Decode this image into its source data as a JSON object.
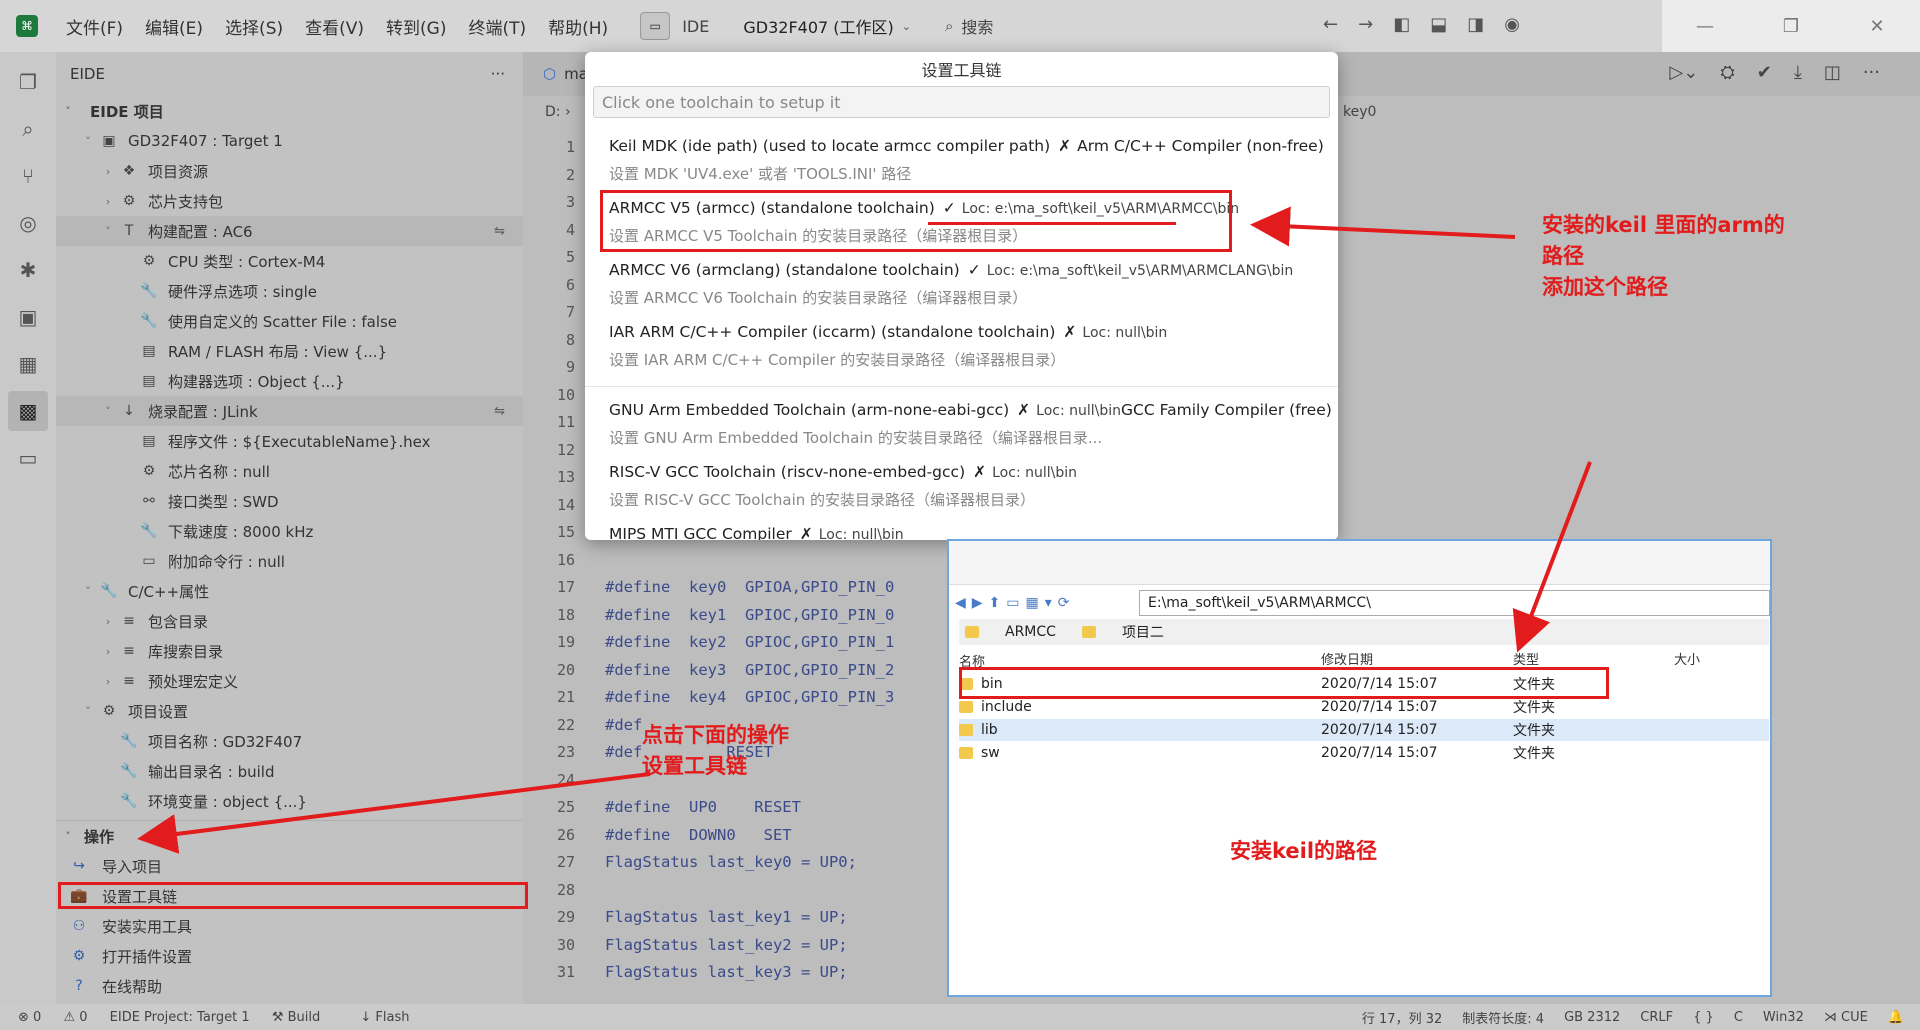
{
  "titlebar": {
    "menu": [
      "文件(F)",
      "编辑(E)",
      "选择(S)",
      "查看(V)",
      "转到(G)",
      "终端(T)",
      "帮助(H)"
    ],
    "ide_label": "IDE",
    "workspace": "GD32F407 (工作区)",
    "search": "搜索"
  },
  "sidebar": {
    "title": "EIDE",
    "more": "···",
    "tree": [
      {
        "label": "EIDE 项目",
        "indent": 0,
        "chev": "˅",
        "icon": "",
        "section": true
      },
      {
        "label": "GD32F407 : Target 1",
        "indent": 1,
        "chev": "˅",
        "icon": "▣"
      },
      {
        "label": "项目资源",
        "indent": 2,
        "chev": "›",
        "icon": "❖"
      },
      {
        "label": "芯片支持包",
        "indent": 2,
        "chev": "›",
        "icon": "⚙"
      },
      {
        "label": "构建配置 : AC6",
        "indent": 2,
        "chev": "˅",
        "icon": "T",
        "sel": true,
        "right": "⇋"
      },
      {
        "label": "CPU 类型 : Cortex-M4",
        "indent": 3,
        "chev": "",
        "icon": "⚙"
      },
      {
        "label": "硬件浮点选项 : single",
        "indent": 3,
        "chev": "",
        "icon": "🔧"
      },
      {
        "label": "使用自定义的 Scatter File : false",
        "indent": 3,
        "chev": "",
        "icon": "🔧"
      },
      {
        "label": "RAM / FLASH 布局 : View {...}",
        "indent": 3,
        "chev": "",
        "icon": "▤"
      },
      {
        "label": "构建器选项 : Object {...}",
        "indent": 3,
        "chev": "",
        "icon": "▤"
      },
      {
        "label": "烧录配置 : JLink",
        "indent": 2,
        "chev": "˅",
        "icon": "↓",
        "sel": true,
        "right": "⇋"
      },
      {
        "label": "程序文件 : ${ExecutableName}.hex",
        "indent": 3,
        "chev": "",
        "icon": "▤"
      },
      {
        "label": "芯片名称 : null",
        "indent": 3,
        "chev": "",
        "icon": "⚙"
      },
      {
        "label": "接口类型 : SWD",
        "indent": 3,
        "chev": "",
        "icon": "⚯"
      },
      {
        "label": "下载速度 : 8000 kHz",
        "indent": 3,
        "chev": "",
        "icon": "🔧"
      },
      {
        "label": "附加命令行 : null",
        "indent": 3,
        "chev": "",
        "icon": "▭"
      },
      {
        "label": "C/C++属性",
        "indent": 1,
        "chev": "˅",
        "icon": "🔧"
      },
      {
        "label": "包含目录",
        "indent": 2,
        "chev": "›",
        "icon": "≡"
      },
      {
        "label": "库搜索目录",
        "indent": 2,
        "chev": "›",
        "icon": "≡"
      },
      {
        "label": "预处理宏定义",
        "indent": 2,
        "chev": "›",
        "icon": "≡"
      },
      {
        "label": "项目设置",
        "indent": 1,
        "chev": "˅",
        "icon": "⚙"
      },
      {
        "label": "项目名称 : GD32F407",
        "indent": 2,
        "chev": "",
        "icon": "🔧"
      },
      {
        "label": "输出目录名 : build",
        "indent": 2,
        "chev": "",
        "icon": "🔧"
      },
      {
        "label": "环境变量 : object {...}",
        "indent": 2,
        "chev": "",
        "icon": "🔧"
      }
    ],
    "ops_title": "操作",
    "ops": [
      {
        "label": "导入项目",
        "icon": "↪"
      },
      {
        "label": "设置工具链",
        "icon": "💼"
      },
      {
        "label": "安装实用工具",
        "icon": "⚇"
      },
      {
        "label": "打开插件设置",
        "icon": "⚙"
      },
      {
        "label": "在线帮助",
        "icon": "?"
      }
    ]
  },
  "editor": {
    "tab": "ma",
    "breadcrumb": "D: ›",
    "bc_right": "key0",
    "lines": [
      "1",
      "2",
      "3",
      "4",
      "5",
      "6",
      "7",
      "8",
      "9",
      "10",
      "11",
      "12",
      "13",
      "14",
      "15",
      "16",
      "17",
      "18",
      "19",
      "20",
      "21",
      "22",
      "23",
      "24",
      "25",
      "26",
      "27",
      "28",
      "29",
      "30",
      "31"
    ],
    "code": [
      "#define  key0  GPIOA,GPIO_PIN_0",
      "#define  key1  GPIOC,GPIO_PIN_0",
      "#define  key2  GPIOC,GPIO_PIN_1",
      "#define  key3  GPIOC,GPIO_PIN_2",
      "#define  key4  GPIOC,GPIO_PIN_3",
      "#def",
      "#def         RESET",
      "",
      "#define  UP0    RESET",
      "#define  DOWN0   SET",
      "FlagStatus last_key0 = UP0;",
      "",
      "FlagStatus last_key1 = UP;",
      "FlagStatus last_key2 = UP;",
      "FlagStatus last_key3 = UP;"
    ]
  },
  "quickpick": {
    "title": "设置工具链",
    "placeholder": "Click one toolchain to setup it",
    "items": [
      {
        "name": "Keil MDK (ide path) (used to locate armcc compiler path)",
        "mark": "✗",
        "loc": "",
        "right": "Arm C/C++ Compiler (non-free)",
        "desc": "设置 MDK 'UV4.exe' 或者 'TOOLS.INI' 路径"
      },
      {
        "name": "ARMCC V5 (armcc) (standalone toolchain)",
        "mark": "✓",
        "loc": "Loc: e:\\ma_soft\\keil_v5\\ARM\\ARMCC\\bin",
        "right": "",
        "desc": "设置 ARMCC V5 Toolchain 的安装目录路径（编译器根目录）"
      },
      {
        "name": "ARMCC V6 (armclang) (standalone toolchain)",
        "mark": "✓",
        "loc": "Loc: e:\\ma_soft\\keil_v5\\ARM\\ARMCLANG\\bin",
        "right": "",
        "desc": "设置 ARMCC V6 Toolchain 的安装目录路径（编译器根目录）"
      },
      {
        "name": "IAR ARM C/C++ Compiler (iccarm) (standalone toolchain)",
        "mark": "✗",
        "loc": "Loc: null\\bin",
        "right": "",
        "desc": "设置 IAR ARM C/C++ Compiler 的安装目录路径（编译器根目录）"
      },
      {
        "name": "GNU Arm Embedded Toolchain (arm-none-eabi-gcc)",
        "mark": "✗",
        "loc": "Loc: null\\bin",
        "right": "GCC Family Compiler (free)",
        "desc": "设置 GNU Arm Embedded Toolchain 的安装目录路径（编译器根目录..."
      },
      {
        "name": "RISC-V GCC Toolchain (riscv-none-embed-gcc)",
        "mark": "✗",
        "loc": "Loc: null\\bin",
        "right": "",
        "desc": "设置 RISC-V GCC Toolchain 的安装目录路径（编译器根目录）"
      },
      {
        "name": "MIPS MTI GCC Compiler",
        "mark": "✗",
        "loc": "Loc: null\\bin",
        "right": "",
        "desc": ""
      }
    ]
  },
  "explorer": {
    "path": "E:\\ma_soft\\keil_v5\\ARM\\ARMCC\\",
    "tabs": [
      "ARMCC",
      "项目二"
    ],
    "headers": [
      "名称",
      "修改日期",
      "类型",
      "大小"
    ],
    "rows": [
      {
        "name": "bin",
        "date": "2020/7/14 15:07",
        "type": "文件夹"
      },
      {
        "name": "include",
        "date": "2020/7/14 15:07",
        "type": "文件夹"
      },
      {
        "name": "lib",
        "date": "2020/7/14 15:07",
        "type": "文件夹"
      },
      {
        "name": "sw",
        "date": "2020/7/14 15:07",
        "type": "文件夹"
      }
    ]
  },
  "annotations": {
    "armcc_note": [
      "安装的keil 里面的arm的",
      "路径",
      "添加这个路径"
    ],
    "click_note": [
      "点击下面的操作",
      "设置工具链"
    ],
    "keil_path_note": "安装keil的路径",
    "accent": "#e21c1c"
  },
  "statusbar": {
    "errors": "⊗ 0",
    "warnings": "⚠ 0",
    "project": "EIDE Project: Target 1",
    "build": "Build",
    "flash": "Flash",
    "position": "行 17，列 32",
    "tab_size": "制表符长度: 4",
    "encoding": "GB 2312",
    "eol": "CRLF",
    "braces": "{ }",
    "lang": "C",
    "platform": "Win32",
    "cue": "CUE"
  }
}
